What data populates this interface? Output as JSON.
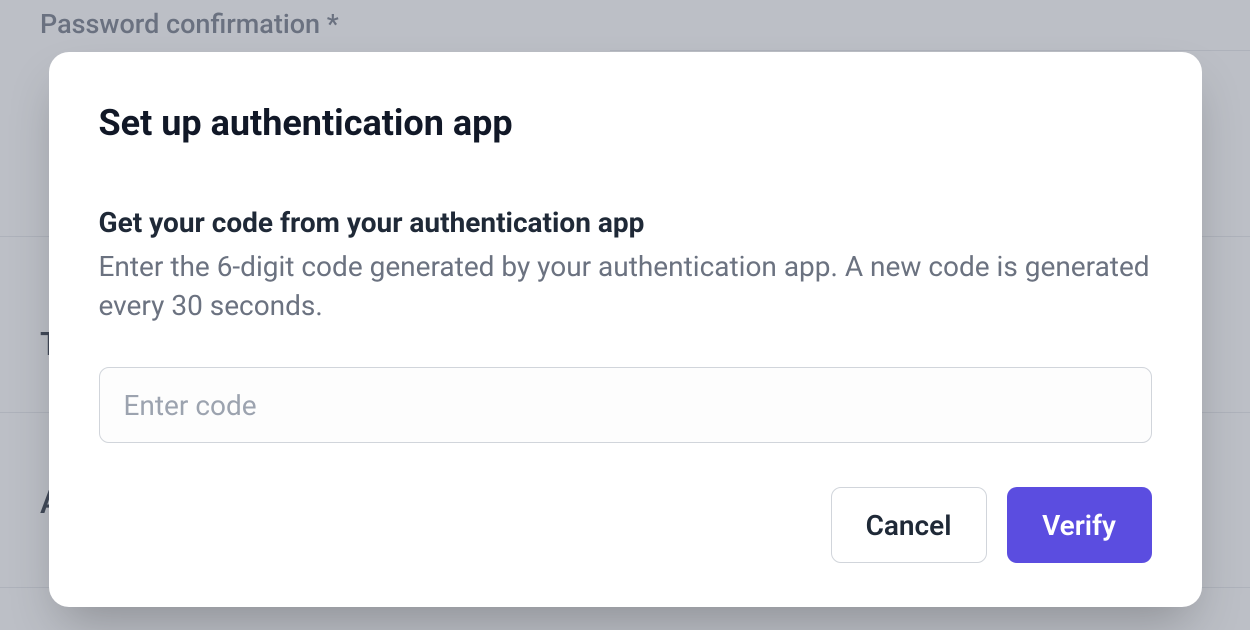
{
  "background": {
    "password_confirmation_label": "Password confirmation *",
    "partial_text_t": "T",
    "partial_text_a": "A"
  },
  "modal": {
    "title": "Set up authentication app",
    "subtitle": "Get your code from your authentication app",
    "description": "Enter the 6-digit code generated by your authentication app. A new code is generated every 30 seconds.",
    "input_placeholder": "Enter code",
    "cancel_label": "Cancel",
    "verify_label": "Verify"
  }
}
